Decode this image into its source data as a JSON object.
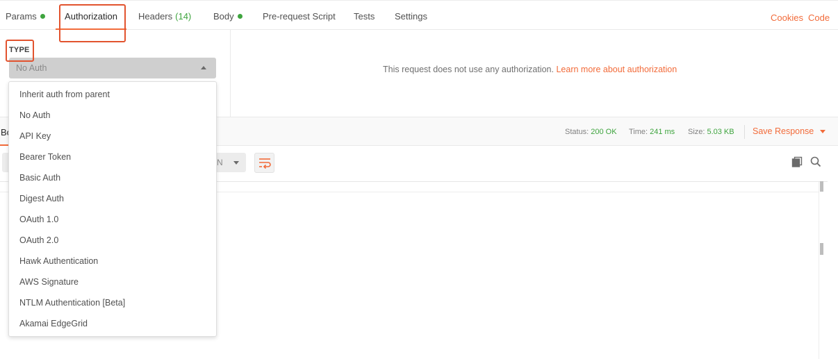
{
  "colors": {
    "accent": "#f26b3a",
    "success": "#3ea43e",
    "annotation": "#e2532e"
  },
  "tabs": [
    {
      "label": "Params",
      "dot": true
    },
    {
      "label": "Authorization",
      "active": true
    },
    {
      "label": "Headers",
      "count": "(14)"
    },
    {
      "label": "Body",
      "dot": true
    },
    {
      "label": "Pre-request Script"
    },
    {
      "label": "Tests"
    },
    {
      "label": "Settings"
    }
  ],
  "top_links": {
    "cookies": "Cookies",
    "code": "Code"
  },
  "auth": {
    "type_label": "TYPE",
    "selected": "No Auth",
    "message": "This request does not use any authorization.",
    "learn_more": "Learn more about authorization",
    "options": [
      "Inherit auth from parent",
      "No Auth",
      "API Key",
      "Bearer Token",
      "Basic Auth",
      "Digest Auth",
      "OAuth 1.0",
      "OAuth 2.0",
      "Hawk Authentication",
      "AWS Signature",
      "NTLM Authentication [Beta]",
      "Akamai EdgeGrid"
    ]
  },
  "response": {
    "tab_label": "Body",
    "status_label": "Status:",
    "status_value": "200 OK",
    "time_label": "Time:",
    "time_value": "241 ms",
    "size_label": "Size:",
    "size_value": "5.03 KB",
    "save_label": "Save Response",
    "format_visible": "N"
  },
  "icons": {
    "wrap": "wrap-lines-icon",
    "copy": "copy-icon",
    "search": "search-icon",
    "select_caret": "chevron-up-icon",
    "save_caret": "chevron-down-icon"
  }
}
